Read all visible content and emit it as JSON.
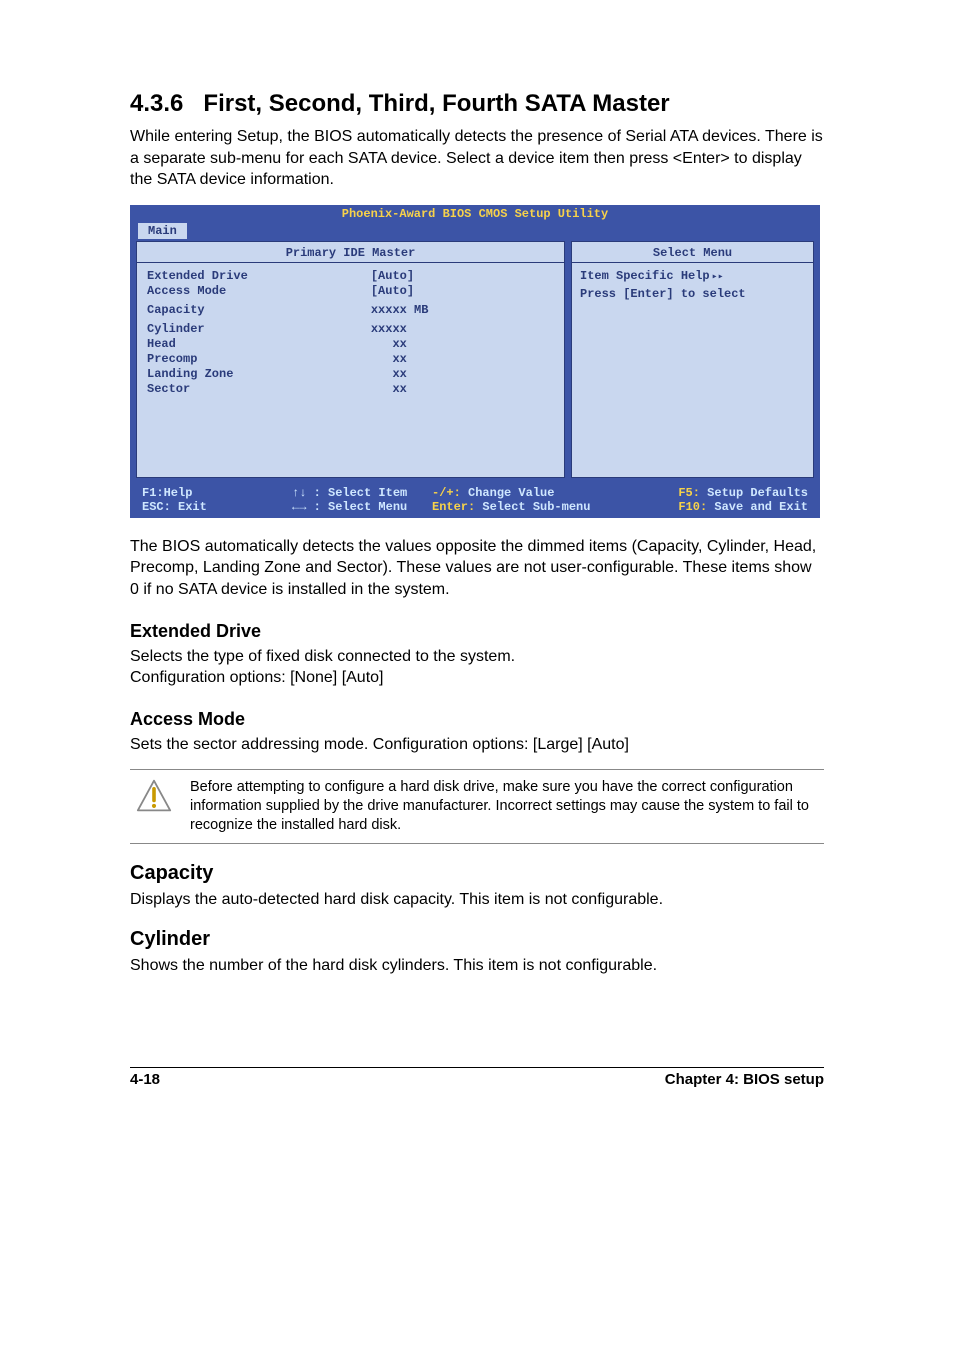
{
  "section": {
    "number": "4.3.6",
    "title": "First, Second, Third, Fourth SATA Master",
    "intro": "While entering Setup, the BIOS automatically detects the presence of Serial ATA devices. There is a separate sub-menu for each SATA device. Select a device item then press <Enter> to display the SATA device information."
  },
  "bios": {
    "title": "Phoenix-Award BIOS CMOS Setup Utility",
    "tab": "Main",
    "left_header": "Primary IDE Master",
    "right_header": "Select Menu",
    "rows": [
      {
        "label": "Extended Drive",
        "value": "[Auto]",
        "selected": true
      },
      {
        "label": "Access Mode",
        "value": "[Auto]"
      },
      {
        "label": "",
        "value": ""
      },
      {
        "label": "Capacity",
        "value": "xxxxx MB"
      },
      {
        "label": "",
        "value": ""
      },
      {
        "label": "Cylinder",
        "value": "xxxxx"
      },
      {
        "label": "Head",
        "value": "   xx"
      },
      {
        "label": "Precomp",
        "value": "   xx"
      },
      {
        "label": "Landing Zone",
        "value": "   xx"
      },
      {
        "label": "Sector",
        "value": "   xx"
      }
    ],
    "help_line1": "Item Specific Help",
    "help_line2": "Press [Enter] to select",
    "footer": {
      "f1": "F1:Help",
      "esc": "ESC: Exit",
      "updown": "↑↓   : Select Item",
      "leftright": "←→   : Select Menu",
      "change": "-/+: Change Value",
      "enter": "Enter: Select Sub-menu",
      "f5": "F5: Setup Defaults",
      "f10": "F10: Save and Exit"
    }
  },
  "after_bios": "The BIOS automatically detects the values opposite the dimmed items (Capacity, Cylinder,  Head, Precomp, Landing Zone and Sector). These values are not user-configurable. These items show 0 if no SATA device is installed in the system.",
  "extended_drive": {
    "heading": "Extended Drive",
    "p1": "Selects the type of fixed disk connected to the system.",
    "p2": "Configuration options: [None] [Auto]"
  },
  "access_mode": {
    "heading": "Access Mode",
    "p": "Sets the sector addressing mode. Configuration options: [Large] [Auto]"
  },
  "note": "Before attempting to configure a hard disk drive, make sure you have the correct configuration information supplied by the drive manufacturer. Incorrect settings may cause the system to fail to recognize the installed hard disk.",
  "capacity": {
    "heading": "Capacity",
    "p": "Displays the auto-detected hard disk capacity. This item is not configurable."
  },
  "cylinder": {
    "heading": "Cylinder",
    "p": "Shows the number of the hard disk cylinders. This item is not configurable."
  },
  "footer": {
    "left": "4-18",
    "right": "Chapter 4: BIOS setup"
  }
}
